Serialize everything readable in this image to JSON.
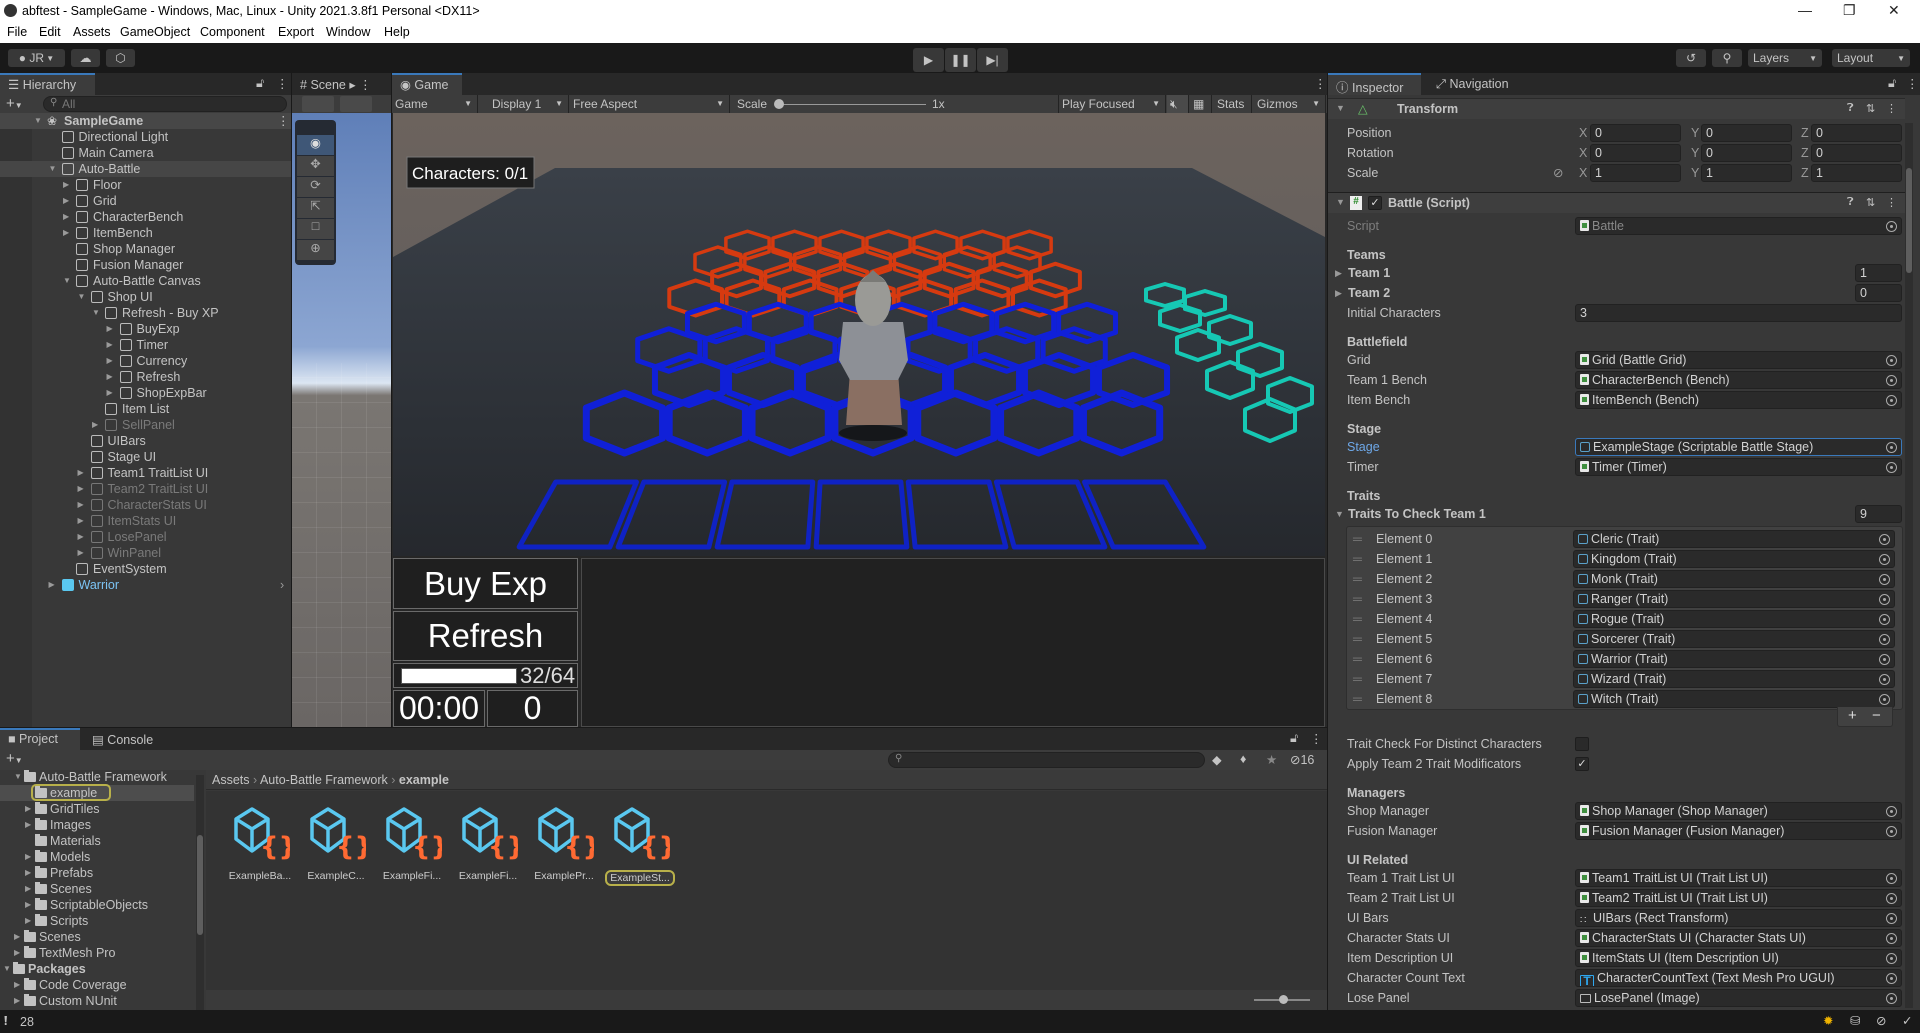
{
  "window": {
    "title": "abftest - SampleGame - Windows, Mac, Linux - Unity 2021.3.8f1 Personal <DX11>"
  },
  "menu": [
    "File",
    "Edit",
    "Assets",
    "GameObject",
    "Component",
    "Export",
    "Window",
    "Help"
  ],
  "toolbar": {
    "account": "JR",
    "layers": "Layers",
    "layout": "Layout"
  },
  "hierarchy": {
    "tab": "Hierarchy",
    "search_placeholder": "All",
    "items": [
      {
        "label": "SampleGame",
        "depth": 0,
        "state": "expanded",
        "type": "scene"
      },
      {
        "label": "Directional Light",
        "depth": 1,
        "state": "none"
      },
      {
        "label": "Main Camera",
        "depth": 1,
        "state": "none"
      },
      {
        "label": "Auto-Battle",
        "depth": 1,
        "state": "expanded",
        "selected": true
      },
      {
        "label": "Floor",
        "depth": 2,
        "state": "collapsed"
      },
      {
        "label": "Grid",
        "depth": 2,
        "state": "collapsed"
      },
      {
        "label": "CharacterBench",
        "depth": 2,
        "state": "collapsed"
      },
      {
        "label": "ItemBench",
        "depth": 2,
        "state": "collapsed"
      },
      {
        "label": "Shop Manager",
        "depth": 2,
        "state": "none"
      },
      {
        "label": "Fusion Manager",
        "depth": 2,
        "state": "none"
      },
      {
        "label": "Auto-Battle Canvas",
        "depth": 2,
        "state": "expanded"
      },
      {
        "label": "Shop UI",
        "depth": 3,
        "state": "expanded"
      },
      {
        "label": "Refresh - Buy XP",
        "depth": 4,
        "state": "expanded"
      },
      {
        "label": "BuyExp",
        "depth": 5,
        "state": "collapsed"
      },
      {
        "label": "Timer",
        "depth": 5,
        "state": "collapsed"
      },
      {
        "label": "Currency",
        "depth": 5,
        "state": "collapsed"
      },
      {
        "label": "Refresh",
        "depth": 5,
        "state": "collapsed"
      },
      {
        "label": "ShopExpBar",
        "depth": 5,
        "state": "collapsed"
      },
      {
        "label": "Item List",
        "depth": 4,
        "state": "none"
      },
      {
        "label": "SellPanel",
        "depth": 4,
        "state": "collapsed",
        "inactive": true
      },
      {
        "label": "UIBars",
        "depth": 3,
        "state": "none"
      },
      {
        "label": "Stage UI",
        "depth": 3,
        "state": "none"
      },
      {
        "label": "Team1 TraitList UI",
        "depth": 3,
        "state": "collapsed"
      },
      {
        "label": "Team2 TraitList UI",
        "depth": 3,
        "state": "collapsed",
        "inactive": true
      },
      {
        "label": "CharacterStats UI",
        "depth": 3,
        "state": "collapsed",
        "inactive": true
      },
      {
        "label": "ItemStats UI",
        "depth": 3,
        "state": "collapsed",
        "inactive": true
      },
      {
        "label": "LosePanel",
        "depth": 3,
        "state": "collapsed",
        "inactive": true
      },
      {
        "label": "WinPanel",
        "depth": 3,
        "state": "collapsed",
        "inactive": true
      },
      {
        "label": "EventSystem",
        "depth": 2,
        "state": "none"
      },
      {
        "label": "Warrior",
        "depth": 1,
        "state": "collapsed",
        "type": "prefab"
      }
    ]
  },
  "scene": {
    "tab": "Scene"
  },
  "game": {
    "tab": "Game",
    "toolbar": {
      "view": "Game",
      "display": "Display 1",
      "aspect": "Free Aspect",
      "scale_label": "Scale",
      "scale_value": "1x",
      "play_mode": "Play Focused",
      "stats": "Stats",
      "gizmos": "Gizmos"
    },
    "hud": {
      "characters": "Characters: 0/1",
      "buy_exp": "Buy Exp",
      "refresh": "Refresh",
      "exp_text": "32/64",
      "exp_fill": 1.0,
      "timer": "00:00",
      "currency": "0"
    },
    "colors": {
      "team1_tiles": "#1020d8",
      "team2_tiles": "#d63a10",
      "bench_tiles": "#16c8b4",
      "item_bench": "#0f22c4"
    }
  },
  "inspector": {
    "tabs": [
      "Inspector",
      "Navigation"
    ],
    "transform": {
      "title": "Transform",
      "rows": [
        {
          "label": "Position",
          "x": "0",
          "y": "0",
          "z": "0"
        },
        {
          "label": "Rotation",
          "x": "0",
          "y": "0",
          "z": "0"
        },
        {
          "label": "Scale",
          "x": "1",
          "y": "1",
          "z": "1"
        }
      ],
      "axes": [
        "X",
        "Y",
        "Z"
      ]
    },
    "battle": {
      "title": "Battle (Script)",
      "enabled": true,
      "rows": [
        {
          "kind": "object",
          "label": "Script",
          "value": "Battle",
          "icon": "script",
          "disabled": true
        },
        {
          "kind": "header",
          "label": "Teams"
        },
        {
          "kind": "foldout-int",
          "label": "Team 1",
          "value": "1"
        },
        {
          "kind": "foldout-int",
          "label": "Team 2",
          "value": "0"
        },
        {
          "kind": "int",
          "label": "Initial Characters",
          "value": "3"
        },
        {
          "kind": "header",
          "label": "Battlefield"
        },
        {
          "kind": "object",
          "label": "Grid",
          "value": "Grid (Battle Grid)",
          "icon": "script"
        },
        {
          "kind": "object",
          "label": "Team 1 Bench",
          "value": "CharacterBench (Bench)",
          "icon": "script"
        },
        {
          "kind": "object",
          "label": "Item Bench",
          "value": "ItemBench (Bench)",
          "icon": "script"
        },
        {
          "kind": "header",
          "label": "Stage"
        },
        {
          "kind": "object",
          "label": "Stage",
          "value": "ExampleStage (Scriptable Battle Stage)",
          "icon": "scriptable",
          "highlight": true
        },
        {
          "kind": "object",
          "label": "Timer",
          "value": "Timer (Timer)",
          "icon": "script"
        },
        {
          "kind": "header",
          "label": "Traits"
        },
        {
          "kind": "foldout-int",
          "label": "Traits To Check Team 1",
          "value": "9",
          "expanded": true
        },
        {
          "kind": "element",
          "label": "Element 0",
          "value": "Cleric (Trait)",
          "icon": "scriptable"
        },
        {
          "kind": "element",
          "label": "Element 1",
          "value": "Kingdom (Trait)",
          "icon": "scriptable"
        },
        {
          "kind": "element",
          "label": "Element 2",
          "value": "Monk (Trait)",
          "icon": "scriptable"
        },
        {
          "kind": "element",
          "label": "Element 3",
          "value": "Ranger (Trait)",
          "icon": "scriptable"
        },
        {
          "kind": "element",
          "label": "Element 4",
          "value": "Rogue (Trait)",
          "icon": "scriptable"
        },
        {
          "kind": "element",
          "label": "Element 5",
          "value": "Sorcerer (Trait)",
          "icon": "scriptable"
        },
        {
          "kind": "element",
          "label": "Element 6",
          "value": "Warrior (Trait)",
          "icon": "scriptable"
        },
        {
          "kind": "element",
          "label": "Element 7",
          "value": "Wizard (Trait)",
          "icon": "scriptable"
        },
        {
          "kind": "element",
          "label": "Element 8",
          "value": "Witch (Trait)",
          "icon": "scriptable"
        },
        {
          "kind": "listbuttons",
          "add": "+",
          "remove": "−"
        },
        {
          "kind": "toggle",
          "label": "Trait Check For Distinct Characters",
          "value": false
        },
        {
          "kind": "toggle",
          "label": "Apply Team 2 Trait Modificators",
          "value": true
        },
        {
          "kind": "header",
          "label": "Managers"
        },
        {
          "kind": "object",
          "label": "Shop Manager",
          "value": "Shop Manager (Shop Manager)",
          "icon": "script"
        },
        {
          "kind": "object",
          "label": "Fusion Manager",
          "value": "Fusion Manager (Fusion Manager)",
          "icon": "script"
        },
        {
          "kind": "header",
          "label": "UI Related"
        },
        {
          "kind": "object",
          "label": "Team 1 Trait List UI",
          "value": "Team1 TraitList UI (Trait List UI)",
          "icon": "script"
        },
        {
          "kind": "object",
          "label": "Team 2 Trait List UI",
          "value": "Team2 TraitList UI (Trait List UI)",
          "icon": "script"
        },
        {
          "kind": "object",
          "label": "UI Bars",
          "value": "UIBars (Rect Transform)",
          "icon": "rect"
        },
        {
          "kind": "object",
          "label": "Character Stats UI",
          "value": "CharacterStats UI (Character Stats UI)",
          "icon": "script"
        },
        {
          "kind": "object",
          "label": "Item Description UI",
          "value": "ItemStats UI (Item Description UI)",
          "icon": "script"
        },
        {
          "kind": "object",
          "label": "Character Count Text",
          "value": "CharacterCountText (Text Mesh Pro UGUI)",
          "icon": "text"
        },
        {
          "kind": "object",
          "label": "Lose Panel",
          "value": "LosePanel (Image)",
          "icon": "image"
        }
      ]
    }
  },
  "project": {
    "tabs": [
      "Project",
      "Console"
    ],
    "hidden_count": "16",
    "breadcrumb": [
      "Assets",
      "Auto-Battle Framework",
      "example"
    ],
    "tree": [
      {
        "label": "Auto-Battle Framework",
        "depth": 1,
        "state": "expanded"
      },
      {
        "label": "example",
        "depth": 2,
        "state": "none",
        "selected": true
      },
      {
        "label": "GridTiles",
        "depth": 2,
        "state": "collapsed"
      },
      {
        "label": "Images",
        "depth": 2,
        "state": "collapsed"
      },
      {
        "label": "Materials",
        "depth": 2,
        "state": "none"
      },
      {
        "label": "Models",
        "depth": 2,
        "state": "collapsed"
      },
      {
        "label": "Prefabs",
        "depth": 2,
        "state": "collapsed"
      },
      {
        "label": "Scenes",
        "depth": 2,
        "state": "collapsed"
      },
      {
        "label": "ScriptableObjects",
        "depth": 2,
        "state": "collapsed"
      },
      {
        "label": "Scripts",
        "depth": 2,
        "state": "collapsed"
      },
      {
        "label": "Scenes",
        "depth": 1,
        "state": "collapsed"
      },
      {
        "label": "TextMesh Pro",
        "depth": 1,
        "state": "collapsed"
      },
      {
        "label": "Packages",
        "depth": 0,
        "state": "expanded",
        "bold": true
      },
      {
        "label": "Code Coverage",
        "depth": 1,
        "state": "collapsed"
      },
      {
        "label": "Custom NUnit",
        "depth": 1,
        "state": "collapsed"
      }
    ],
    "assets": [
      {
        "label": "ExampleBa..."
      },
      {
        "label": "ExampleC..."
      },
      {
        "label": "ExampleFi..."
      },
      {
        "label": "ExampleFi..."
      },
      {
        "label": "ExamplePr..."
      },
      {
        "label": "ExampleSt...",
        "selected": true
      }
    ]
  },
  "status": {
    "message_count": "28"
  }
}
